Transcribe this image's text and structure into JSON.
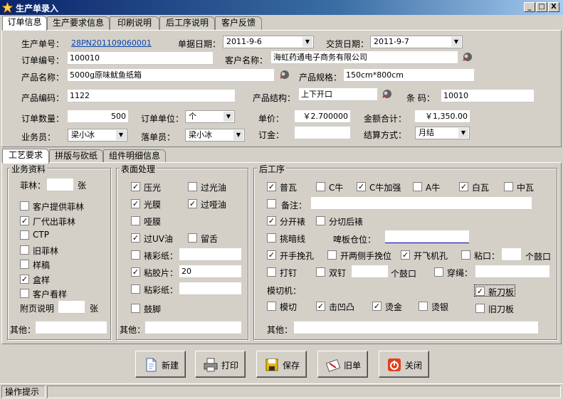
{
  "window": {
    "title": "生产单录入",
    "min": "_",
    "max": "□",
    "close": "X"
  },
  "tabs": [
    "订单信息",
    "生产要求信息",
    "印刷说明",
    "后工序说明",
    "客户反馈"
  ],
  "order": {
    "prod_no_label": "生产单号：",
    "prod_no": "28PN201109060001",
    "date_label": "单据日期：",
    "date": "2011-9-6",
    "delivery_label": "交货日期：",
    "delivery": "2011-9-7",
    "order_no_label": "订单编号：",
    "order_no": "100010",
    "customer_label": "客户名称：",
    "customer": "海虹药通电子商务有限公司",
    "product_label": "产品名称：",
    "product": "5000g原味鱿鱼纸箱",
    "spec_label": "产品规格：",
    "spec": "150cm*800cm",
    "code_label": "产品编码：",
    "code": "1122",
    "structure_label": "产品结构：",
    "structure": "上下开口",
    "barcode_label": "条   码：",
    "barcode": "10010",
    "qty_label": "订单数量：",
    "qty": "500",
    "unit_label": "订单单位：",
    "unit": "个",
    "price_label": "单价：",
    "price": "￥2.700000",
    "total_label": "金额合计：",
    "total": "￥1,350.00",
    "sales_label": "业务员：",
    "sales": "梁小冰",
    "clerk_label": "落单员：",
    "clerk": "梁小冰",
    "deposit_label": "订金：",
    "deposit": "",
    "settle_label": "结算方式：",
    "settle": "月结"
  },
  "subtabs": [
    "工艺要求",
    "拼版与砍纸",
    "组件明细信息"
  ],
  "business": {
    "title": "业务资料",
    "film_label": "菲林：",
    "film_unit": "张",
    "items": [
      {
        "label": "客户提供菲林",
        "checked": false
      },
      {
        "label": "厂代出菲林",
        "checked": true
      },
      {
        "label": "CTP",
        "checked": false
      },
      {
        "label": "旧菲林",
        "checked": false
      },
      {
        "label": "样稿",
        "checked": false
      },
      {
        "label": "盒样",
        "checked": true
      },
      {
        "label": "客户看样",
        "checked": false
      }
    ],
    "attach_label": "附页说明",
    "attach_unit": "张",
    "other_label": "其他："
  },
  "surface": {
    "title": "表面处理",
    "items": [
      {
        "label": "压光",
        "checked": true
      },
      {
        "label": "过光油",
        "checked": false
      },
      {
        "label": "光膜",
        "checked": true
      },
      {
        "label": "过哑油",
        "checked": true
      },
      {
        "label": "哑膜",
        "checked": false
      },
      {
        "label": "过UV油",
        "checked": true
      },
      {
        "label": "留舌",
        "checked": false
      },
      {
        "label": "裱彩纸：",
        "checked": false
      },
      {
        "label": "粘胶片：",
        "checked": true,
        "value": "20"
      },
      {
        "label": "粘彩纸：",
        "checked": false
      },
      {
        "label": "鼓脚",
        "checked": false
      }
    ],
    "other_label": "其他："
  },
  "post": {
    "title": "后工序",
    "row1": [
      {
        "label": "普瓦",
        "checked": true
      },
      {
        "label": "C牛",
        "checked": false
      },
      {
        "label": "C牛加强",
        "checked": true
      },
      {
        "label": "A牛",
        "checked": false
      },
      {
        "label": "白瓦",
        "checked": true
      },
      {
        "label": "中瓦",
        "checked": false
      }
    ],
    "remark_label": "备注：",
    "split_before": "分开裱",
    "split_after": "分切后裱",
    "dark_line": "挑暗线",
    "beer_label": "啤板仓位：",
    "row4": [
      {
        "label": "开手挽孔",
        "checked": true
      },
      {
        "label": "开两侧手挽位",
        "checked": false
      },
      {
        "label": "开飞机孔",
        "checked": true
      },
      {
        "label": "粘口：",
        "checked": false
      }
    ],
    "nail_unit": "个鼓口",
    "row5": [
      {
        "label": "打钉",
        "checked": false
      },
      {
        "label": "双钉",
        "checked": false
      },
      {
        "label": "穿绳：",
        "checked": false
      }
    ],
    "nail2_unit": "个鼓口",
    "die_label": "模切机：",
    "new_knife": "新刀板",
    "old_knife": "旧刀板",
    "row7": [
      {
        "label": "模切",
        "checked": false
      },
      {
        "label": "击凹凸",
        "checked": true
      },
      {
        "label": "烫金",
        "checked": true
      },
      {
        "label": "烫银",
        "checked": false
      }
    ],
    "other_label": "其他："
  },
  "buttons": {
    "new": "新建",
    "print": "打印",
    "save": "保存",
    "old": "旧单",
    "close": "关闭"
  },
  "status": {
    "hint": "操作提示"
  }
}
